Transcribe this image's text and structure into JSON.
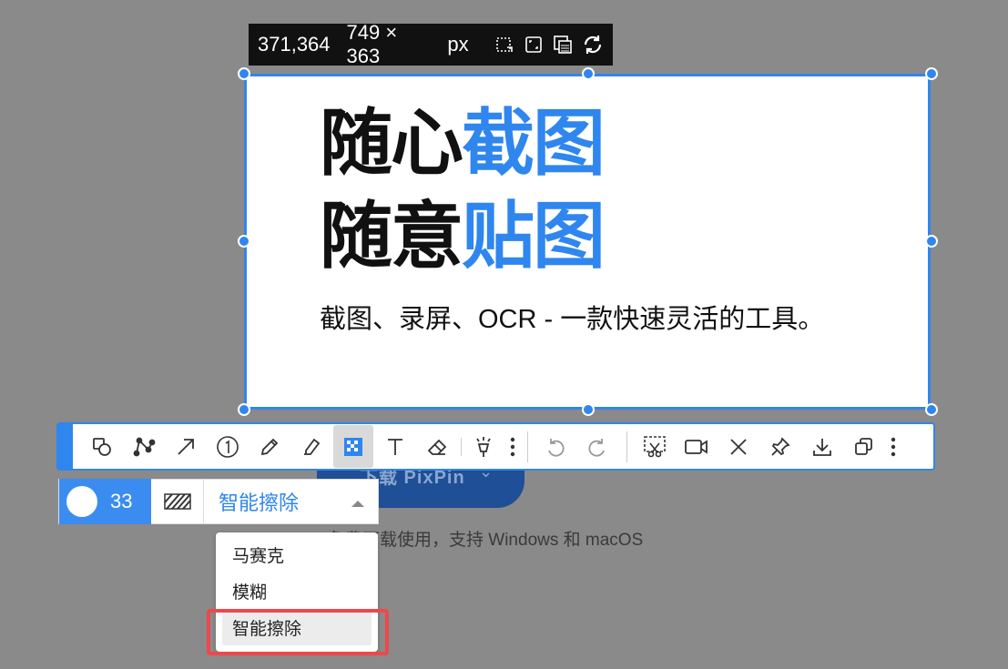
{
  "background": {
    "download_label": "下载 PixPin",
    "subtext": "免费下载使用，支持 Windows 和 macOS"
  },
  "info_bar": {
    "position": "371,364",
    "size": "749 × 363",
    "unit": "px",
    "icons": [
      "select-region-icon",
      "fit-region-icon",
      "window-capture-icon",
      "refresh-icon"
    ]
  },
  "selection": {
    "headline_line1_black": "随心",
    "headline_line1_blue": "截图",
    "headline_line2_black": "随意",
    "headline_line2_blue": "贴图",
    "lead": "截图、录屏、OCR - 一款快速灵活的工具。"
  },
  "toolbar": {
    "tools": [
      {
        "name": "shape-tool",
        "active": false
      },
      {
        "name": "polyline-tool",
        "active": false
      },
      {
        "name": "arrow-tool",
        "active": false
      },
      {
        "name": "number-tool",
        "active": false
      },
      {
        "name": "pen-tool",
        "active": false
      },
      {
        "name": "highlighter-tool",
        "active": false
      },
      {
        "name": "mosaic-tool",
        "active": true
      },
      {
        "name": "text-tool",
        "active": false
      },
      {
        "name": "eraser-tool",
        "active": false
      },
      {
        "name": "magic-tool",
        "active": false
      }
    ],
    "actions": [
      "undo",
      "redo",
      "scissor-capture",
      "record",
      "close",
      "pin",
      "download",
      "copy"
    ]
  },
  "options": {
    "brush_size": "33",
    "mode_selected": "智能擦除",
    "mode_options": [
      "马赛克",
      "模糊",
      "智能擦除"
    ]
  },
  "colors": {
    "accent": "#2f86ee",
    "highlight": "#f0474b",
    "overlay": "#8a8a8a"
  }
}
